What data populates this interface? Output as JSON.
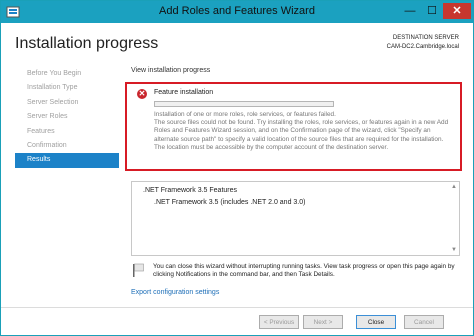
{
  "window": {
    "title": "Add Roles and Features Wizard",
    "min_glyph": "—",
    "max_glyph": "☐",
    "close_glyph": "✕"
  },
  "header": {
    "title": "Installation progress",
    "dest_label": "DESTINATION SERVER",
    "dest_value": "CAM-DC2.Cambridge.local"
  },
  "sidebar": {
    "items": [
      {
        "label": "Before You Begin",
        "active": false
      },
      {
        "label": "Installation Type",
        "active": false
      },
      {
        "label": "Server Selection",
        "active": false
      },
      {
        "label": "Server Roles",
        "active": false
      },
      {
        "label": "Features",
        "active": false
      },
      {
        "label": "Confirmation",
        "active": false
      },
      {
        "label": "Results",
        "active": true
      }
    ]
  },
  "content": {
    "view_label": "View installation progress",
    "error": {
      "icon_glyph": "✕",
      "title": "Feature installation",
      "progress": 0,
      "line1": "Installation of one or more roles, role services, or features failed.",
      "message": "The source files could not be found. Try installing the roles, role services, or features again in a new Add Roles and Features Wizard session, and on the Confirmation page of the wizard, click \"Specify an alternate source path\" to specify a valid location of the source files that are required for the installation. The location must be accessible by the computer account of the destination server."
    },
    "results": {
      "feature": ".NET Framework 3.5 Features",
      "sub_feature": ".NET Framework 3.5 (includes .NET 2.0 and 3.0)",
      "scroll_up": "▲",
      "scroll_down": "▼"
    },
    "note": "You can close this wizard without interrupting running tasks. View task progress or open this page again by clicking Notifications in the command bar, and then Task Details.",
    "export_link": "Export configuration settings"
  },
  "footer": {
    "previous": "< Previous",
    "next": "Next >",
    "close": "Close",
    "cancel": "Cancel"
  },
  "colors": {
    "titlebar": "#1ba1c0",
    "active_nav": "#1c82c8",
    "error_border": "#d71b25",
    "link": "#1e6fb8"
  }
}
